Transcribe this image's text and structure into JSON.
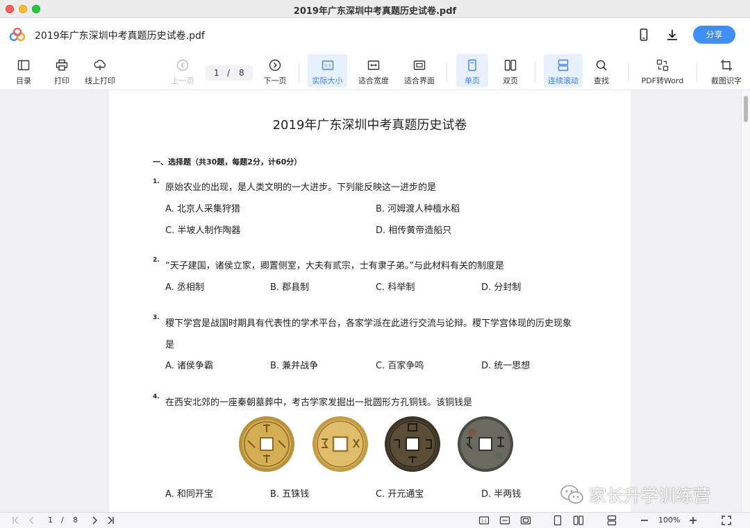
{
  "window": {
    "title": "2019年广东深圳中考真题历史试卷.pdf"
  },
  "app": {
    "doc_title": "2019年广东深圳中考真题历史试卷.pdf",
    "share_label": "分享",
    "icons": [
      "app-logo-icon",
      "mobile-icon",
      "download-icon"
    ]
  },
  "toolbar": {
    "toc": "目录",
    "print": "打印",
    "online_print": "线上打印",
    "prev": "上一页",
    "page_current": "1",
    "page_sep": "/",
    "page_total": "8",
    "next": "下一页",
    "actual_size": "实际大小",
    "fit_width": "适合宽度",
    "fit_page": "适合界面",
    "single": "单页",
    "double": "双页",
    "continuous": "连续滚动",
    "find": "查找",
    "pdf_to_word": "PDF转Word",
    "ocr": "截图识字",
    "accent": "#3d82ea"
  },
  "paper": {
    "title": "2019年广东深圳中考真题历史试卷",
    "section": "一、选择题（共30题，每题2分，计60分）",
    "questions": [
      {
        "num": "1.",
        "text": "原始农业的出现，是人类文明的一大进步。下列能反映这一进步的是",
        "options": [
          "A. 北京人采集狩猎",
          "B. 河姆渡人种植水稻",
          "C. 半坡人制作陶器",
          "D. 相传黄帝造船只"
        ]
      },
      {
        "num": "2.",
        "text": "“天子建国，诸侯立家，卿置侧室，大夫有贰宗，士有隶子弟。”与此材料有关的制度是",
        "options": [
          "A. 丞相制",
          "B. 郡县制",
          "C. 科举制",
          "D. 分封制"
        ]
      },
      {
        "num": "3.",
        "text": "稷下学宫是战国时期具有代表性的学术平台，各家学派在此进行交流与论辩。稷下学宫体现的历史现象",
        "text2": "是",
        "options": [
          "A. 诸侯争霸",
          "B. 兼并战争",
          "C. 百家争鸣",
          "D. 统一思想"
        ]
      },
      {
        "num": "4.",
        "text": "在西安北郊的一座秦朝墓葬中，考古学家发掘出一批圆形方孔铜钱。该铜钱是",
        "options": [
          "A. 和同开宝",
          "B. 五铢钱",
          "C. 开元通宝",
          "D. 半两钱"
        ]
      }
    ]
  },
  "watermark": {
    "text": "家长升学训练营"
  },
  "status": {
    "page_current": "1",
    "page_sep": "/",
    "page_total": "8",
    "zoom": "100%"
  }
}
